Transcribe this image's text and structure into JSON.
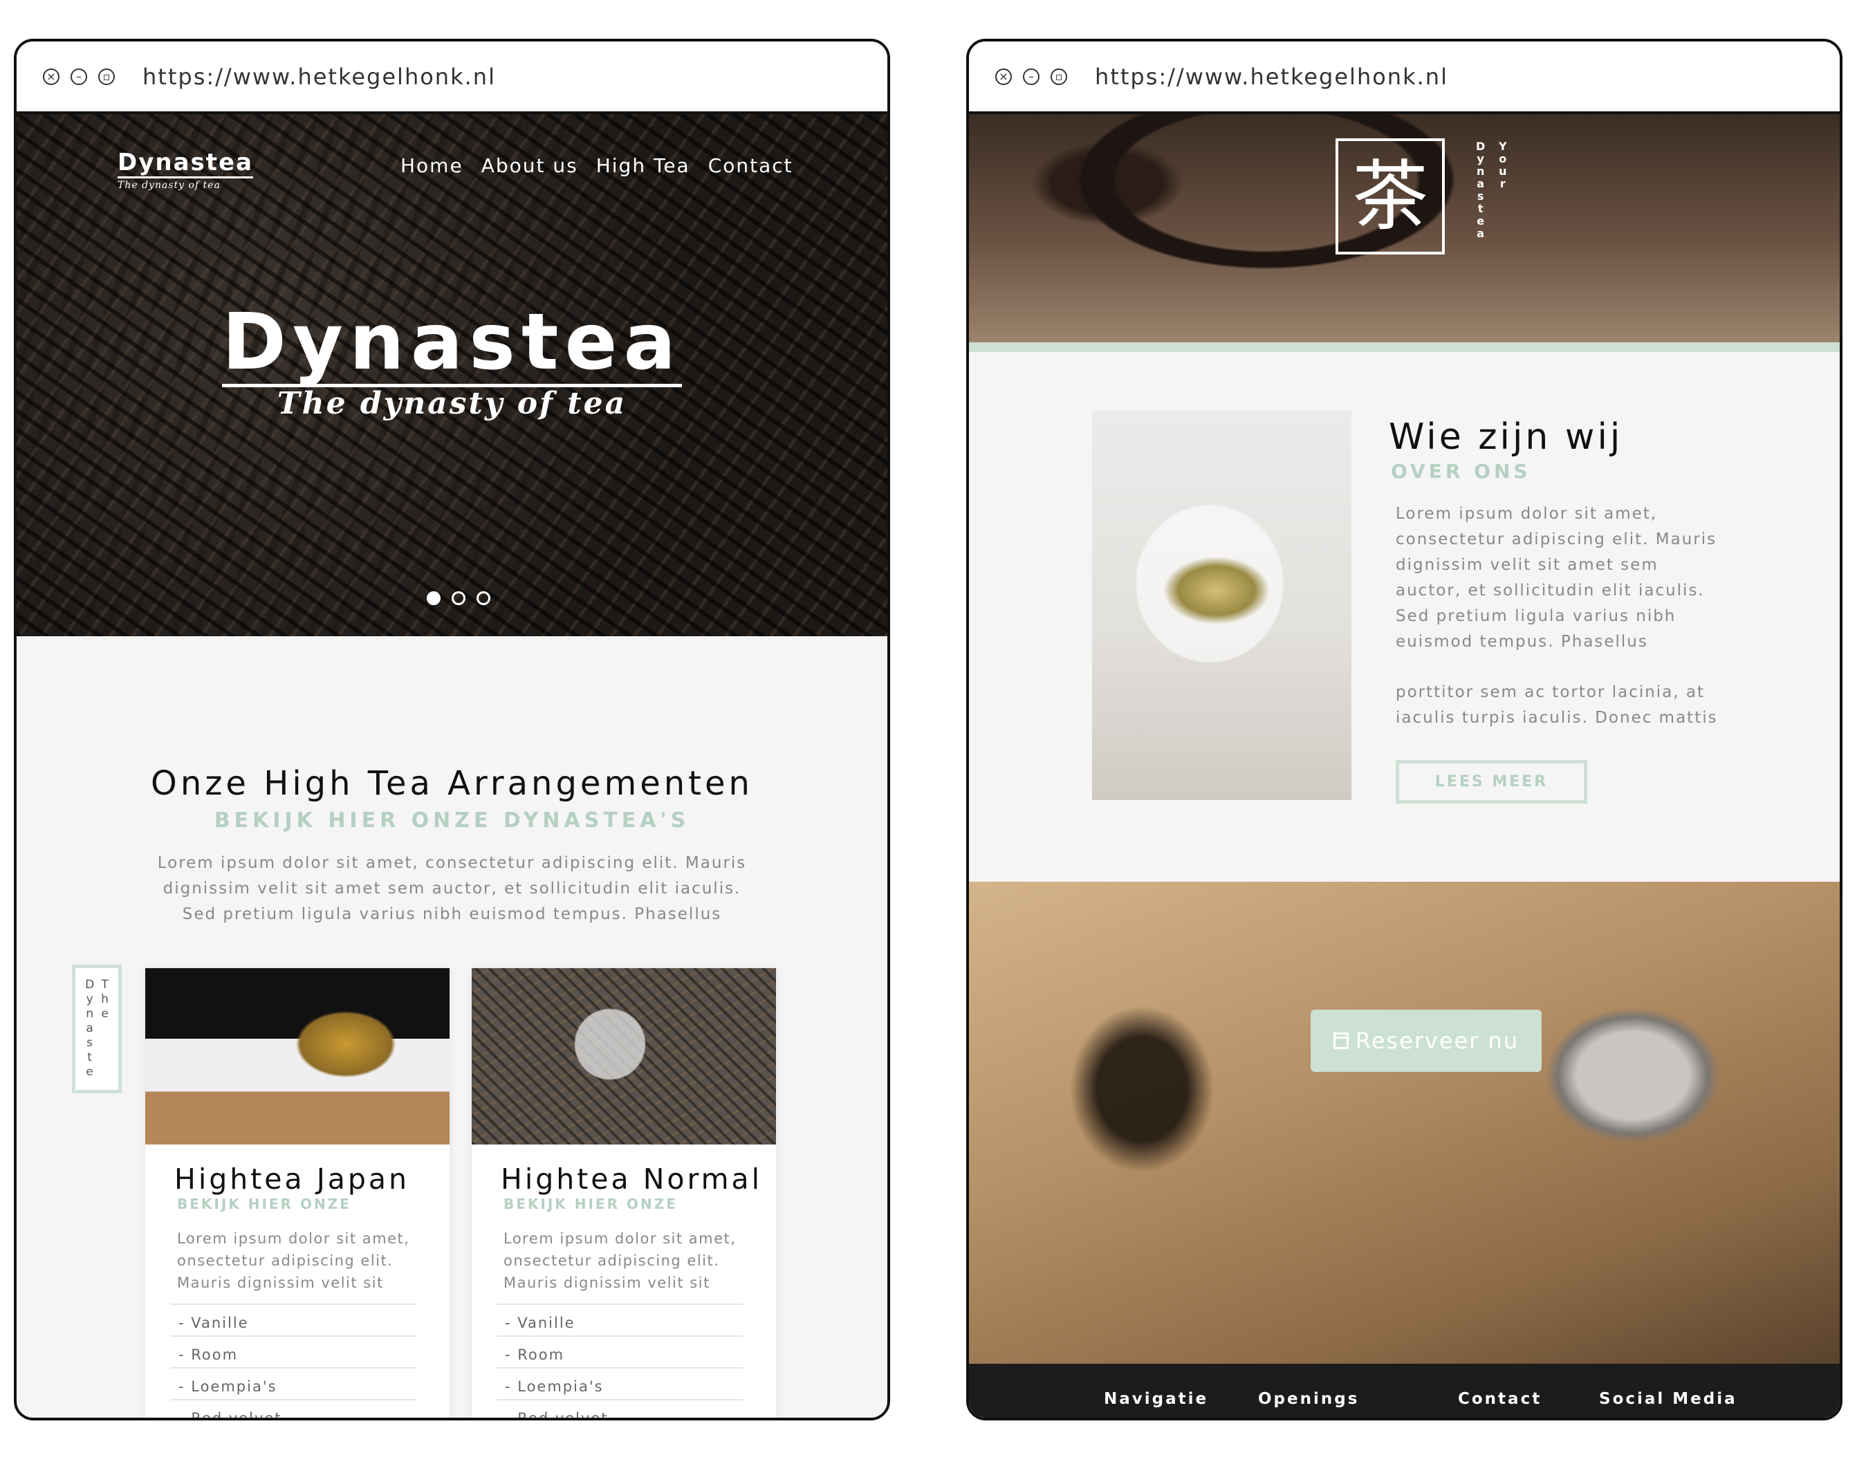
{
  "left_window": {
    "url": "https://www.hetkegelhonk.nl",
    "logo": {
      "name": "Dynastea",
      "tagline": "The dynasty of tea"
    },
    "nav": [
      "Home",
      "About us",
      "High Tea",
      "Contact"
    ],
    "hero": {
      "title": "Dynastea",
      "subtitle": "The dynasty of tea",
      "slides": 3,
      "active_slide": 1
    },
    "section": {
      "title": "Onze High Tea Arrangementen",
      "subtitle": "BEKIJK HIER ONZE DYNASTEA'S",
      "paragraph_lines": [
        "Lorem ipsum dolor sit amet, consectetur adipiscing elit. Mauris",
        "dignissim velit sit amet sem auctor, et sollicitudin elit iaculis.",
        "Sed pretium ligula varius nibh euismod tempus. Phasellus"
      ]
    },
    "vertical_tag": {
      "col1": [
        "D",
        "y",
        "n",
        "a",
        "s",
        "t",
        "e"
      ],
      "col2": [
        "T",
        "h",
        "e"
      ]
    },
    "cards": [
      {
        "title": "Hightea Japan",
        "subtitle": "BEKIJK HIER ONZE",
        "desc_lines": [
          "Lorem ipsum dolor sit amet,",
          "onsectetur adipiscing elit.",
          "Mauris dignissim velit sit"
        ],
        "items": [
          "- Vanille",
          "- Room",
          "- Loempia's",
          "- Red velvet"
        ]
      },
      {
        "title": "Hightea Normal",
        "subtitle": "BEKIJK HIER ONZE",
        "desc_lines": [
          "Lorem ipsum dolor sit amet,",
          "onsectetur adipiscing elit.",
          "Mauris dignissim velit sit"
        ],
        "items": [
          "- Vanille",
          "- Room",
          "- Loempia's",
          "- Red velvet"
        ]
      }
    ]
  },
  "right_window": {
    "url": "https://www.hetkegelhonk.nl",
    "header": {
      "kanji": "茶",
      "vertical_label_1": [
        "D",
        "y",
        "n",
        "a",
        "s",
        "t",
        "e",
        "a"
      ],
      "vertical_label_2": [
        "Y",
        "o",
        "u",
        "r"
      ]
    },
    "about": {
      "title": "Wie zijn wij",
      "subtitle": "OVER ONS",
      "paragraph1_lines": [
        "Lorem ipsum dolor sit amet,",
        "consectetur adipiscing elit. Mauris",
        "dignissim velit sit amet sem",
        "auctor, et sollicitudin elit iaculis.",
        "Sed pretium ligula varius nibh",
        "euismod tempus. Phasellus"
      ],
      "paragraph2_lines": [
        "porttitor sem ac tortor lacinia, at",
        "iaculis turpis iaculis. Donec mattis"
      ],
      "button": "LEES MEER"
    },
    "cta": {
      "button": "Reserveer nu",
      "icon": "calendar-icon"
    },
    "footer": {
      "columns": [
        "Navigatie",
        "Openings",
        "Contact",
        "Social Media"
      ]
    }
  },
  "colors": {
    "mint": "#cde0d4",
    "mint_text": "#b5d0c2",
    "footer": "#1c1c1c"
  }
}
